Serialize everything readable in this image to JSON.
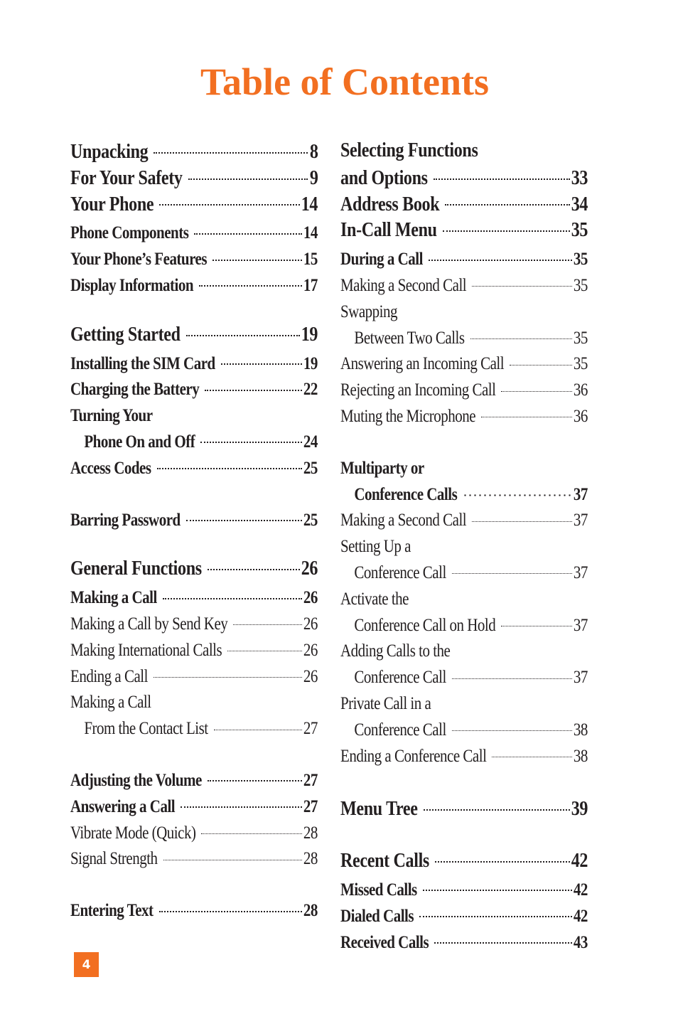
{
  "title": "Table of Contents",
  "page_number": "4",
  "accent_color": "#f26f21",
  "left_column": [
    {
      "label": "Unpacking",
      "page": "8",
      "style": "major"
    },
    {
      "label": "For Your Safety",
      "page": "9",
      "style": "major"
    },
    {
      "label": "Your Phone",
      "page": "14",
      "style": "major"
    },
    {
      "label": "Phone Components",
      "page": "14",
      "style": "sub"
    },
    {
      "label": "Your Phone’s Features",
      "page": "15",
      "style": "sub"
    },
    {
      "label": "Display Information",
      "page": "17",
      "style": "sub"
    },
    {
      "label": "Getting Started",
      "page": "19",
      "style": "major"
    },
    {
      "label": "Installing the SIM Card",
      "page": "19",
      "style": "sub"
    },
    {
      "label": "Charging the Battery",
      "page": "22",
      "style": "sub"
    },
    {
      "label": "Turning Your",
      "page": "",
      "style": "sub"
    },
    {
      "label": "Phone On and Off",
      "page": "24",
      "style": "sub",
      "indent": true
    },
    {
      "label": "Access Codes",
      "page": "25",
      "style": "sub"
    },
    {
      "label": "Barring Password",
      "page": "25",
      "style": "sub"
    },
    {
      "label": "General Functions",
      "page": "26",
      "style": "major"
    },
    {
      "label": "Making a Call",
      "page": "26",
      "style": "sub"
    },
    {
      "label": "Making a Call by Send Key",
      "page": "26",
      "style": "reg"
    },
    {
      "label": "Making International Calls",
      "page": "26",
      "style": "reg"
    },
    {
      "label": "Ending a Call",
      "page": "26",
      "style": "reg"
    },
    {
      "label": "Making a Call",
      "page": "",
      "style": "reg"
    },
    {
      "label": "From the Contact List",
      "page": "27",
      "style": "reg",
      "indent": true
    },
    {
      "label": "Adjusting the Volume",
      "page": "27",
      "style": "sub"
    },
    {
      "label": "Answering a Call",
      "page": "27",
      "style": "sub"
    },
    {
      "label": "Vibrate Mode (Quick)",
      "page": "28",
      "style": "reg"
    },
    {
      "label": "Signal Strength",
      "page": "28",
      "style": "reg"
    },
    {
      "label": "Entering Text",
      "page": "28",
      "style": "sub"
    }
  ],
  "right_column": [
    {
      "label": "Selecting Functions",
      "page": "",
      "style": "major"
    },
    {
      "label": "and Options",
      "page": "33",
      "style": "major"
    },
    {
      "label": "Address Book",
      "page": "34",
      "style": "major"
    },
    {
      "label": "In-Call Menu",
      "page": "35",
      "style": "major"
    },
    {
      "label": "During a Call",
      "page": "35",
      "style": "sub"
    },
    {
      "label": "Making a Second Call",
      "page": "35",
      "style": "reg"
    },
    {
      "label": "Swapping",
      "page": "",
      "style": "reg"
    },
    {
      "label": "Between Two Calls",
      "page": "35",
      "style": "reg",
      "indent": true
    },
    {
      "label": "Answering an Incoming Call",
      "page": "35",
      "style": "reg"
    },
    {
      "label": "Rejecting an Incoming Call",
      "page": "36",
      "style": "reg"
    },
    {
      "label": "Muting the Microphone",
      "page": "36",
      "style": "reg"
    },
    {
      "label": "Multiparty or",
      "page": "",
      "style": "sub"
    },
    {
      "label": "Conference Calls",
      "page": "37",
      "style": "sub",
      "indent": true
    },
    {
      "label": "Making a Second Call",
      "page": "37",
      "style": "reg"
    },
    {
      "label": "Setting Up a",
      "page": "",
      "style": "reg"
    },
    {
      "label": "Conference Call",
      "page": "37",
      "style": "reg",
      "indent": true
    },
    {
      "label": "Activate the",
      "page": "",
      "style": "reg"
    },
    {
      "label": "Conference Call on Hold",
      "page": "37",
      "style": "reg",
      "indent": true
    },
    {
      "label": "Adding Calls to the",
      "page": "",
      "style": "reg"
    },
    {
      "label": "Conference Call",
      "page": "37",
      "style": "reg",
      "indent": true
    },
    {
      "label": "Private Call in a",
      "page": "",
      "style": "reg"
    },
    {
      "label": "Conference Call",
      "page": "38",
      "style": "reg",
      "indent": true
    },
    {
      "label": "Ending a Conference Call",
      "page": "38",
      "style": "reg"
    },
    {
      "label": "Menu Tree",
      "page": "39",
      "style": "major"
    },
    {
      "label": "Recent Calls",
      "page": "42",
      "style": "major"
    },
    {
      "label": "Missed Calls",
      "page": "42",
      "style": "sub"
    },
    {
      "label": "Dialed Calls",
      "page": "42",
      "style": "sub"
    },
    {
      "label": "Received Calls",
      "page": "43",
      "style": "sub"
    }
  ]
}
